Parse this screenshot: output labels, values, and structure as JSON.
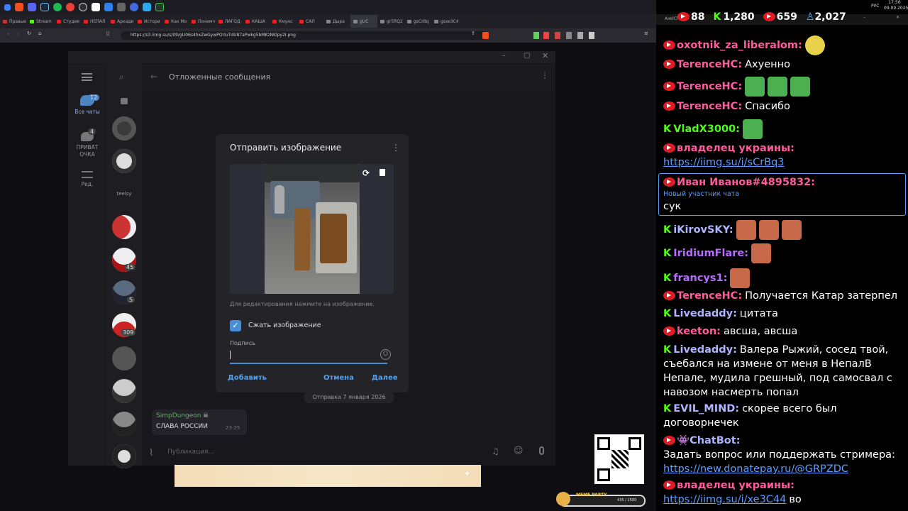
{
  "system": {
    "lang": "РУС",
    "time": "17:56",
    "date": "09.09.2025"
  },
  "browser": {
    "tabs": [
      "Правые",
      "Stream",
      "Студия",
      "НЕПАЛ",
      "Аркади",
      "Истори",
      "Как Мо",
      "Понимч",
      "ЛАГОД",
      "КАША",
      "Кмунс",
      "САЛ",
      "Дыра",
      "gUC",
      "gr5RQ2",
      "gsCrBq",
      "gsxe3C4"
    ],
    "url": "https://s3.iimg.su/s/09/gU06s4hxZwGywPOrIuTdU87aPwkg5bMKzNKlpy2I.png"
  },
  "telegram": {
    "header_title": "Отложенные сообщения",
    "folders": [
      {
        "label": "Все чаты",
        "badge": "12"
      },
      {
        "label": "ПРИВАТОЧКА",
        "badge": "4"
      },
      {
        "label": "Ред."
      }
    ],
    "chat_badges": [
      "45",
      "5",
      "309"
    ],
    "chat_text_avatar": "teelsy",
    "dialog": {
      "title": "Отправить изображение",
      "hint": "Для редактирования нажмите на изображение.",
      "compress_label": "Сжать изображение",
      "compress_checked": true,
      "caption_label": "Подпись",
      "add_button": "Добавить",
      "cancel_button": "Отмена",
      "next_button": "Далее"
    },
    "date_pill": "Отправка 7 января 2026",
    "message": {
      "author": "SimpDungeon",
      "text": "СЛАВА РОССИИ",
      "time": "23:25"
    },
    "input_placeholder": "Публикация..."
  },
  "overlay": {
    "meme_party_label": "MEME PARTY",
    "meme_party_count": "435 / 1500"
  },
  "chat": {
    "app_name": "AxelChat",
    "stats": {
      "youtube_likes": "88",
      "kick_viewers": "1,280",
      "youtube_viewers": "659",
      "total_viewers": "2,027"
    },
    "messages": [
      {
        "platform": "youtube",
        "nick": "oxotnik_za_liberalom:",
        "color": "#ff5b9d",
        "text": ""
      },
      {
        "platform": "youtube",
        "nick": "TerenceHC:",
        "color": "#ff5b9d",
        "text": "Ахуенно"
      },
      {
        "platform": "youtube",
        "nick": "TerenceHC:",
        "color": "#ff5b9d",
        "text": ""
      },
      {
        "platform": "youtube",
        "nick": "TerenceHC:",
        "color": "#ff5b9d",
        "text": "Спасибо"
      },
      {
        "platform": "kick",
        "nick": "VladX3000:",
        "color": "#53fc18",
        "text": ""
      },
      {
        "platform": "youtube",
        "nick": "владелец украины:",
        "color": "#ff5b9d",
        "text": "",
        "link": "https://iimg.su/i/sCrBq3"
      },
      {
        "platform": "youtube",
        "nick": "Иван Иванов#4895832:",
        "color": "#ff5b9d",
        "sub": "Новый участник чата",
        "text": "сук"
      },
      {
        "platform": "kick",
        "nick": "iKirovSKY:",
        "color": "#aeb4ff",
        "text": ""
      },
      {
        "platform": "kick",
        "nick": "IridiumFlare:",
        "color": "#b76cff",
        "text": ""
      },
      {
        "platform": "kick",
        "nick": "francys1:",
        "color": "#b76cff",
        "text": ""
      },
      {
        "platform": "youtube",
        "nick": "TerenceHC:",
        "color": "#ff5b9d",
        "text": "Получается Катар затерпел"
      },
      {
        "platform": "kick",
        "nick": "Livedaddy:",
        "color": "#aeb4ff",
        "text": "цитата"
      },
      {
        "platform": "youtube",
        "nick": "keeton:",
        "color": "#ff5b9d",
        "text": "авсша, авсша"
      },
      {
        "platform": "kick",
        "nick": "Livedaddy:",
        "color": "#aeb4ff",
        "text": "Валера Рыжий, сосед твой, съебался на измене от меня в НепалВ Непале, мудила грешный, под самосвал с навозом насмерть попал"
      },
      {
        "platform": "kick",
        "nick": "EVIL_MIND:",
        "color": "#aeb4ff",
        "text": "скорее всего был договорнечек"
      },
      {
        "platform": "youtube",
        "nick": "ChatBot:",
        "color": "#aeb4ff",
        "text": "Задать вопрос или поддержать стримера:",
        "link": "https://new.donatepay.ru/@GRPZDC"
      },
      {
        "platform": "youtube",
        "nick": "владелец украины:",
        "color": "#ff5b9d",
        "text": "во",
        "link": "https://iimg.su/i/xe3C44"
      }
    ]
  }
}
